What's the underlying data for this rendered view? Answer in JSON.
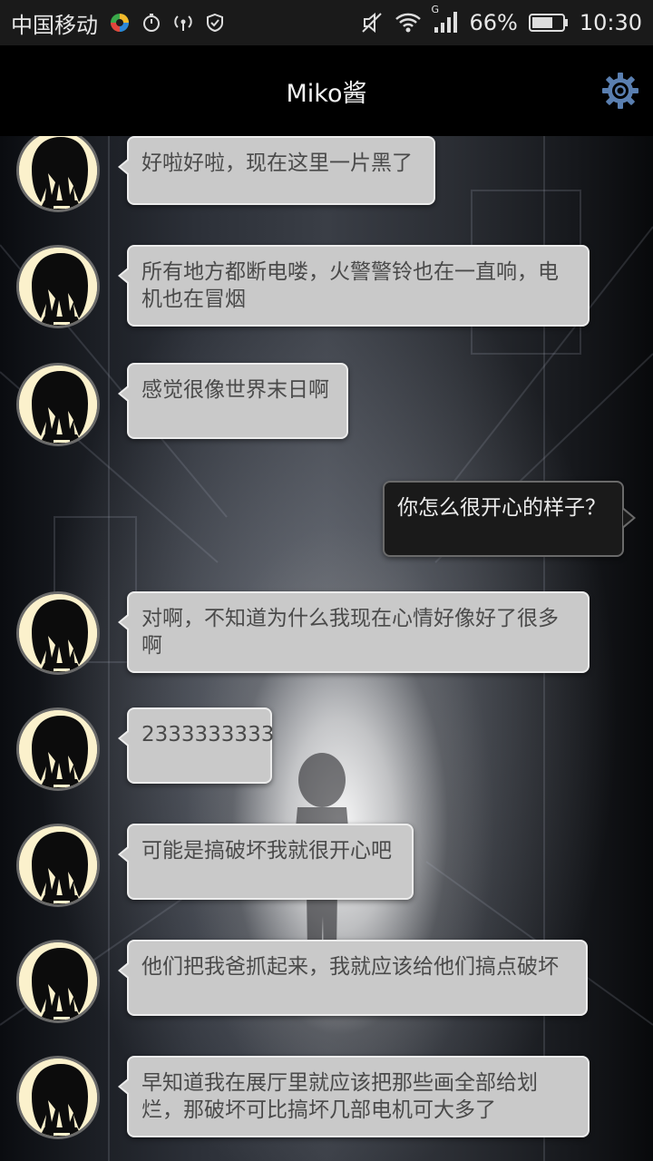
{
  "status_bar": {
    "carrier": "中国移动",
    "battery_percent": "66%",
    "time": "10:30",
    "network_type": "G",
    "icons": [
      "app-colorful-icon",
      "stopwatch-icon",
      "wifi-hotspot-icon",
      "shield-icon",
      "mute-icon",
      "wifi-icon",
      "signal-icon",
      "battery-icon"
    ]
  },
  "header": {
    "title": "Miko酱",
    "settings_icon": "gear-icon"
  },
  "colors": {
    "incoming_bubble": "#c9c9c9",
    "outgoing_bubble": "#1a1a1a",
    "avatar_bg": "#fbf1cc",
    "gear": "#5a7fb0"
  },
  "messages": [
    {
      "side": "left",
      "text": "好啦好啦，现在这里一片黑了"
    },
    {
      "side": "left",
      "text": "所有地方都断电喽，火警警铃也在一直响，电\n机也在冒烟"
    },
    {
      "side": "left",
      "text": "感觉很像世界末日啊"
    },
    {
      "side": "right",
      "text": "你怎么很开心的样子？"
    },
    {
      "side": "left",
      "text": "对啊，不知道为什么我现在心情好像好了很多\n啊"
    },
    {
      "side": "left",
      "text": "2333333333"
    },
    {
      "side": "left",
      "text": "可能是搞破坏我就很开心吧"
    },
    {
      "side": "left",
      "text": "他们把我爸抓起来，我就应该给他们搞点破坏"
    },
    {
      "side": "left",
      "text": "早知道我在展厅里就应该把那些画全部给划\n烂，那破坏可比搞坏几部电机可大多了"
    }
  ]
}
